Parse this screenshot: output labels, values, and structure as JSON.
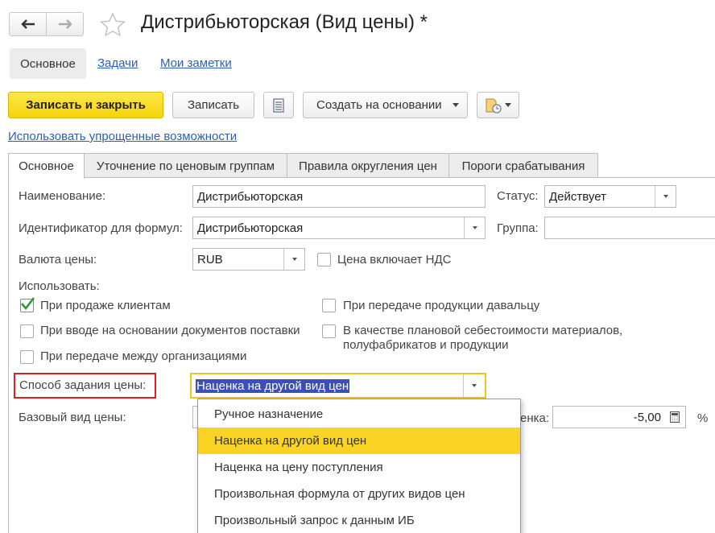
{
  "header": {
    "title": "Дистрибьюторская (Вид цены) *"
  },
  "sections": {
    "active": "Основное",
    "tasks": "Задачи",
    "notes": "Мои заметки"
  },
  "toolbar": {
    "save_close": "Записать и закрыть",
    "save": "Записать",
    "create_based": "Создать на основании"
  },
  "simplified_link": "Использовать упрощенные возможности",
  "tabs": [
    {
      "label": "Основное"
    },
    {
      "label": "Уточнение по ценовым группам"
    },
    {
      "label": "Правила округления цен"
    },
    {
      "label": "Пороги срабатывания"
    }
  ],
  "form": {
    "name_label": "Наименование:",
    "name_value": "Дистрибьюторская",
    "status_label": "Статус:",
    "status_value": "Действует",
    "ident_label": "Идентификатор для формул:",
    "ident_value": "Дистрибьюторская",
    "group_label": "Группа:",
    "group_value": "",
    "currency_label": "Валюта цены:",
    "currency_value": "RUB",
    "vat_label": "Цена включает НДС",
    "vat_checked": false,
    "use_label": "Использовать:",
    "use_options": [
      {
        "label": "При продаже клиентам",
        "checked": true
      },
      {
        "label": "При передаче продукции давальцу",
        "checked": false
      },
      {
        "label": "При вводе на основании документов поставки",
        "checked": false
      },
      {
        "label_line1": "В качестве плановой себестоимости материалов,",
        "label_line2": "полуфабрикатов и продукции",
        "checked": false
      },
      {
        "label": "При передаче между организациями",
        "checked": false
      }
    ],
    "method_label": "Способ задания цены:",
    "method_value": "Наценка на другой вид цен",
    "base_label": "Базовый вид цены:",
    "markup_label_partial": "енка:",
    "markup_value": "-5,00",
    "markup_unit": "%"
  },
  "dropdown": {
    "items": [
      {
        "label": "Ручное назначение",
        "selected": false
      },
      {
        "label": "Наценка на другой вид цен",
        "selected": true
      },
      {
        "label": "Наценка на цену поступления",
        "selected": false
      },
      {
        "label": "Произвольная формула от других видов цен",
        "selected": false
      },
      {
        "label": "Произвольный запрос к данным ИБ",
        "selected": false
      }
    ]
  },
  "colors": {
    "accent_yellow": "#f5d40a",
    "link_blue": "#2f5fb1",
    "selection_blue": "#3b4fb8",
    "highlight_red": "#e02020",
    "check_green": "#2e9c3a",
    "dropdown_selected": "#f9d424"
  }
}
